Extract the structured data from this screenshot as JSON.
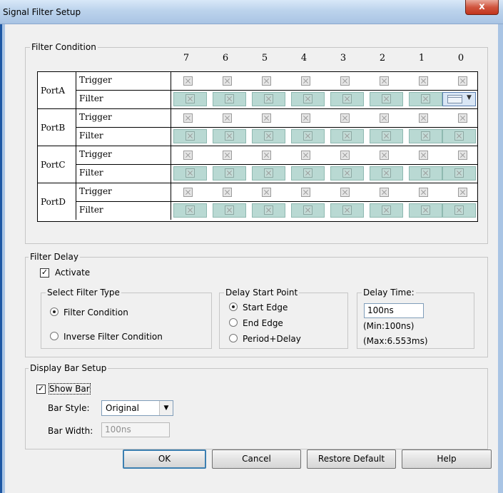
{
  "window": {
    "title": "Signal Filter Setup",
    "close_glyph": "x"
  },
  "filter_condition": {
    "group_label": "Filter Condition",
    "columns": [
      "7",
      "6",
      "5",
      "4",
      "3",
      "2",
      "1",
      "0"
    ],
    "ports": [
      {
        "name": "PortA",
        "rows": [
          "Trigger",
          "Filter"
        ]
      },
      {
        "name": "PortB",
        "rows": [
          "Trigger",
          "Filter"
        ]
      },
      {
        "name": "PortC",
        "rows": [
          "Trigger",
          "Filter"
        ]
      },
      {
        "name": "PortD",
        "rows": [
          "Trigger",
          "Filter"
        ]
      }
    ]
  },
  "filter_delay": {
    "group_label": "Filter Delay",
    "activate_label": "Activate",
    "activate_checked": true,
    "select_filter_type": {
      "label": "Select Filter Type",
      "options": [
        "Filter Condition",
        "Inverse Filter Condition"
      ],
      "selected": "Filter Condition"
    },
    "delay_start_point": {
      "label": "Delay Start Point",
      "options": [
        "Start Edge",
        "End Edge",
        "Period+Delay"
      ],
      "selected": "Start Edge"
    },
    "delay_time": {
      "label": "Delay Time:",
      "value": "100ns",
      "min": "(Min:100ns)",
      "max": "(Max:6.553ms)"
    }
  },
  "display_bar": {
    "group_label": "Display Bar Setup",
    "show_bar_label": "Show Bar",
    "show_bar_checked": true,
    "bar_style_label": "Bar Style:",
    "bar_style_value": "Original",
    "bar_width_label": "Bar Width:",
    "bar_width_value": "100ns"
  },
  "buttons": {
    "ok": "OK",
    "cancel": "Cancel",
    "restore_default": "Restore Default",
    "help": "Help"
  },
  "icons": {
    "check": "✓",
    "dropdown": "▼"
  }
}
